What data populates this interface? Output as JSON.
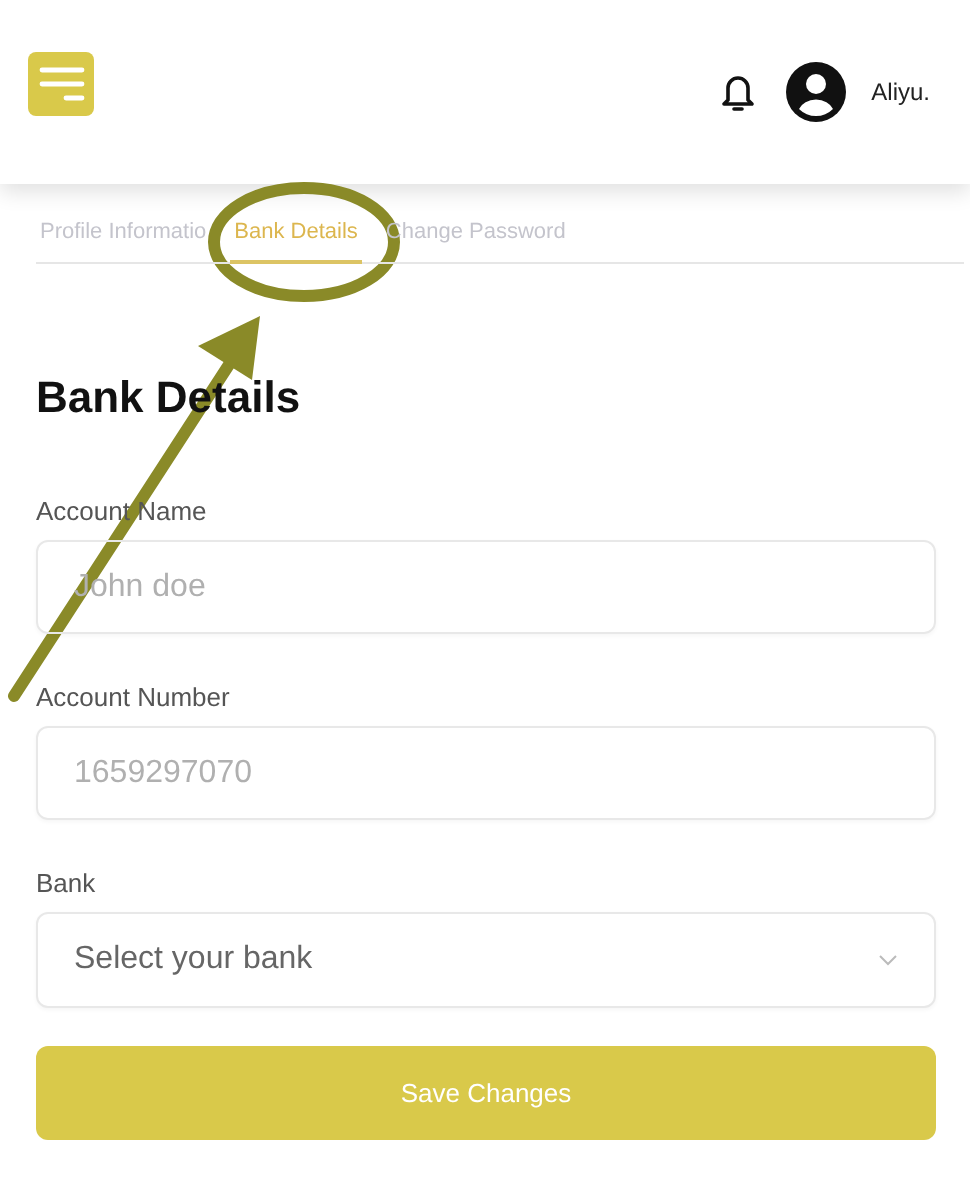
{
  "header": {
    "user_name": "Aliyu."
  },
  "tabs": [
    {
      "label": "Profile Informatio",
      "selected": false
    },
    {
      "label": "Bank Details",
      "selected": true
    },
    {
      "label": "Change Password",
      "selected": false
    }
  ],
  "heading": "Bank Details",
  "fields": [
    {
      "kind": "text",
      "label": "Account Name",
      "placeholder": "John doe"
    },
    {
      "kind": "text",
      "label": "Account Number",
      "placeholder": "1659297070"
    },
    {
      "kind": "select",
      "label": "Bank",
      "placeholder": "Select your bank"
    }
  ],
  "submit": "Save Changes"
}
